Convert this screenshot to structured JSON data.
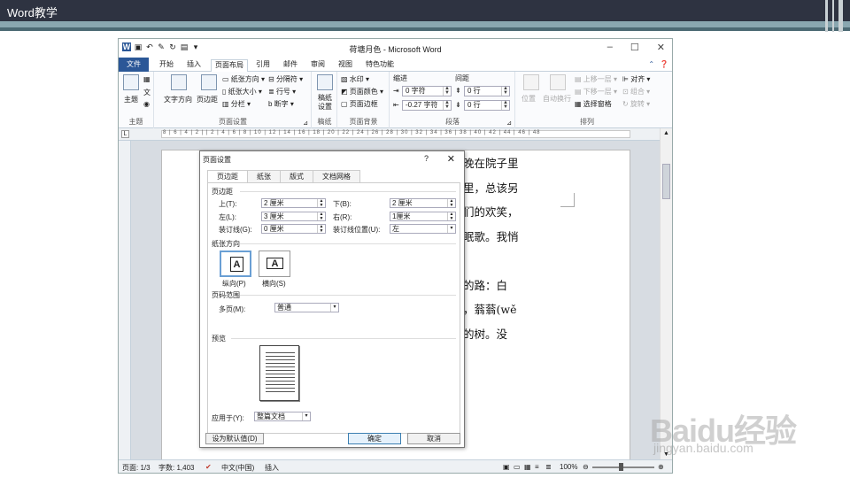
{
  "slide": {
    "title": "Word教学"
  },
  "window": {
    "title": "荷塘月色 - Microsoft Word",
    "tabs": [
      "文件",
      "开始",
      "插入",
      "页面布局",
      "引用",
      "邮件",
      "审阅",
      "视图",
      "特色功能"
    ]
  },
  "ribbon": {
    "groups": {
      "theme": {
        "label": "主题",
        "button": "主题"
      },
      "page_setup": {
        "label": "页面设置",
        "text_direction": "文字方向",
        "margins": "页边距",
        "orientation": "纸张方向",
        "size": "纸张大小",
        "columns": "分栏",
        "breaks": "分隔符",
        "line_numbers": "行号",
        "hyphenation": "断字"
      },
      "manuscript": {
        "label": "稿纸",
        "button": "稿纸设置"
      },
      "page_background": {
        "label": "页面背景",
        "watermark": "水印",
        "page_color": "页面颜色",
        "page_borders": "页面边框"
      },
      "paragraph": {
        "label": "段落",
        "indent_title": "缩进",
        "indent_left": "0 字符",
        "indent_right": "-0.27 字符",
        "spacing_title": "间距",
        "spacing_before": "0 行",
        "spacing_after": "0 行"
      },
      "arrange": {
        "label": "排列",
        "position": "位置",
        "wrap": "自动换行",
        "bring_forward": "上移一层",
        "send_backward": "下移一层",
        "selection_pane": "选择窗格",
        "align": "对齐",
        "group": "组合",
        "rotate": "旋转"
      }
    }
  },
  "ruler": {
    "numbers": "8 | 6 | 4 | 2 |  | 2 | 4 | 6 | 8 | 10 | 12 | 14 | 16 | 18 | 20 | 22 | 24 | 26 | 28 | 30 | 32 | 34 | 36 | 38 | 40 | 42 | 44 | 46 | 48"
  },
  "document": {
    "lines": [
      "宁静。今晚在院子里",
      "满月的光里，总该另",
      "路上孩子们的欢笑，",
      "目地哼着眠歌。我悄",
      "",
      "一条幽僻的路：白",
      "着许多树，蓊蓊(wě",
      "知道名字的树。没"
    ]
  },
  "status": {
    "page": "页面: 1/3",
    "words": "字数: 1,403",
    "language": "中文(中国)",
    "mode": "插入",
    "zoom": "100%"
  },
  "dialog": {
    "title": "页面设置",
    "help": "?",
    "tabs": [
      "页边距",
      "纸张",
      "版式",
      "文档网格"
    ],
    "margins_section": "页边距",
    "top_label": "上(T):",
    "top_value": "2 厘米",
    "bottom_label": "下(B):",
    "bottom_value": "2 厘米",
    "left_label": "左(L):",
    "left_value": "3 厘米",
    "right_label": "右(R):",
    "right_value": "1厘米",
    "gutter_label": "装订线(G):",
    "gutter_value": "0 厘米",
    "gutter_pos_label": "装订线位置(U):",
    "gutter_pos_value": "左",
    "orientation_section": "纸张方向",
    "portrait": "纵向(P)",
    "landscape": "横向(S)",
    "pages_section": "页码范围",
    "multiple_label": "多页(M):",
    "multiple_value": "普通",
    "preview_section": "预览",
    "apply_label": "应用于(Y):",
    "apply_value": "整篇文档",
    "default_button": "设为默认值(D)",
    "ok_button": "确定",
    "cancel_button": "取消"
  },
  "watermark": {
    "brand": "Baidu经验",
    "url": "jingyan.baidu.com"
  }
}
